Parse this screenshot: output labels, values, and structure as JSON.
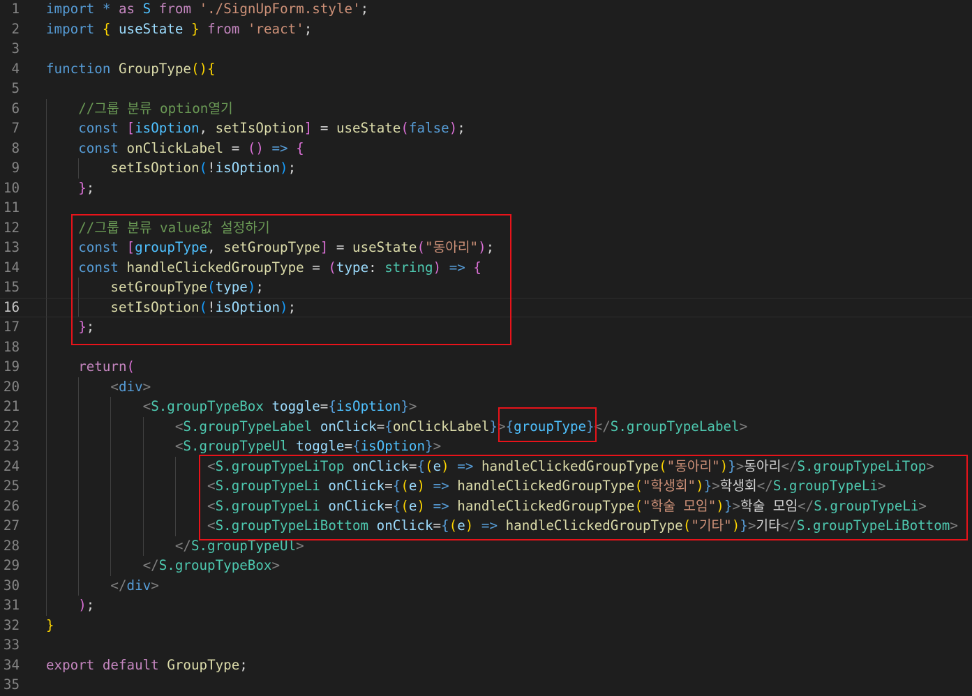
{
  "editor": {
    "current_line": 16,
    "colors": {
      "background": "#1e1e1e",
      "highlight_box": "#e8131a"
    },
    "lines": [
      {
        "n": "1",
        "tokens": [
          [
            "kw",
            "import"
          ],
          [
            "op",
            " "
          ],
          [
            "kw",
            "*"
          ],
          [
            "op",
            " "
          ],
          [
            "ctl",
            "as"
          ],
          [
            "op",
            " "
          ],
          [
            "cst",
            "S"
          ],
          [
            "op",
            " "
          ],
          [
            "ctl",
            "from"
          ],
          [
            "op",
            " "
          ],
          [
            "str",
            "'./SignUpForm.style'"
          ],
          [
            "op",
            ";"
          ]
        ]
      },
      {
        "n": "2",
        "tokens": [
          [
            "kw",
            "import"
          ],
          [
            "op",
            " "
          ],
          [
            "b1",
            "{"
          ],
          [
            "op",
            " "
          ],
          [
            "var",
            "useState"
          ],
          [
            "op",
            " "
          ],
          [
            "b1",
            "}"
          ],
          [
            "op",
            " "
          ],
          [
            "ctl",
            "from"
          ],
          [
            "op",
            " "
          ],
          [
            "str",
            "'react'"
          ],
          [
            "op",
            ";"
          ]
        ]
      },
      {
        "n": "3",
        "tokens": []
      },
      {
        "n": "4",
        "tokens": [
          [
            "kw",
            "function"
          ],
          [
            "op",
            " "
          ],
          [
            "fn",
            "GroupType"
          ],
          [
            "b1",
            "()"
          ],
          [
            "b1",
            "{"
          ]
        ]
      },
      {
        "n": "5",
        "tokens": []
      },
      {
        "n": "6",
        "tokens": [
          [
            "op",
            "    "
          ],
          [
            "cmt",
            "//그룹 분류 option열기"
          ]
        ]
      },
      {
        "n": "7",
        "tokens": [
          [
            "op",
            "    "
          ],
          [
            "kw",
            "const"
          ],
          [
            "op",
            " "
          ],
          [
            "b2",
            "["
          ],
          [
            "cst",
            "isOption"
          ],
          [
            "op",
            ", "
          ],
          [
            "fn",
            "setIsOption"
          ],
          [
            "b2",
            "]"
          ],
          [
            "op",
            " = "
          ],
          [
            "fn",
            "useState"
          ],
          [
            "b2",
            "("
          ],
          [
            "kw",
            "false"
          ],
          [
            "b2",
            ")"
          ],
          [
            "op",
            ";"
          ]
        ]
      },
      {
        "n": "8",
        "tokens": [
          [
            "op",
            "    "
          ],
          [
            "kw",
            "const"
          ],
          [
            "op",
            " "
          ],
          [
            "fn",
            "onClickLabel"
          ],
          [
            "op",
            " = "
          ],
          [
            "b2",
            "()"
          ],
          [
            "op",
            " "
          ],
          [
            "kw",
            "=>"
          ],
          [
            "op",
            " "
          ],
          [
            "b2",
            "{"
          ]
        ]
      },
      {
        "n": "9",
        "tokens": [
          [
            "op",
            "        "
          ],
          [
            "fn",
            "setIsOption"
          ],
          [
            "b3",
            "("
          ],
          [
            "op",
            "!"
          ],
          [
            "var",
            "isOption"
          ],
          [
            "b3",
            ")"
          ],
          [
            "op",
            ";"
          ]
        ]
      },
      {
        "n": "10",
        "tokens": [
          [
            "op",
            "    "
          ],
          [
            "b2",
            "}"
          ],
          [
            "op",
            ";"
          ]
        ]
      },
      {
        "n": "11",
        "tokens": []
      },
      {
        "n": "12",
        "tokens": [
          [
            "op",
            "    "
          ],
          [
            "cmt",
            "//그룹 분류 value값 설정하기"
          ]
        ]
      },
      {
        "n": "13",
        "tokens": [
          [
            "op",
            "    "
          ],
          [
            "kw",
            "const"
          ],
          [
            "op",
            " "
          ],
          [
            "b2",
            "["
          ],
          [
            "cst",
            "groupType"
          ],
          [
            "op",
            ", "
          ],
          [
            "fn",
            "setGroupType"
          ],
          [
            "b2",
            "]"
          ],
          [
            "op",
            " = "
          ],
          [
            "fn",
            "useState"
          ],
          [
            "b2",
            "("
          ],
          [
            "str",
            "\"동아리\""
          ],
          [
            "b2",
            ")"
          ],
          [
            "op",
            ";"
          ]
        ]
      },
      {
        "n": "14",
        "tokens": [
          [
            "op",
            "    "
          ],
          [
            "kw",
            "const"
          ],
          [
            "op",
            " "
          ],
          [
            "fn",
            "handleClickedGroupType"
          ],
          [
            "op",
            " = "
          ],
          [
            "b2",
            "("
          ],
          [
            "var",
            "type"
          ],
          [
            "op",
            ": "
          ],
          [
            "typ",
            "string"
          ],
          [
            "b2",
            ")"
          ],
          [
            "op",
            " "
          ],
          [
            "kw",
            "=>"
          ],
          [
            "op",
            " "
          ],
          [
            "b2",
            "{"
          ]
        ]
      },
      {
        "n": "15",
        "tokens": [
          [
            "op",
            "        "
          ],
          [
            "fn",
            "setGroupType"
          ],
          [
            "b3",
            "("
          ],
          [
            "var",
            "type"
          ],
          [
            "b3",
            ")"
          ],
          [
            "op",
            ";"
          ]
        ]
      },
      {
        "n": "16",
        "tokens": [
          [
            "op",
            "        "
          ],
          [
            "fn",
            "setIsOption"
          ],
          [
            "b3",
            "("
          ],
          [
            "op",
            "!"
          ],
          [
            "var",
            "isOption"
          ],
          [
            "b3",
            ")"
          ],
          [
            "op",
            ";"
          ]
        ]
      },
      {
        "n": "17",
        "tokens": [
          [
            "op",
            "    "
          ],
          [
            "b2",
            "}"
          ],
          [
            "op",
            ";"
          ]
        ]
      },
      {
        "n": "18",
        "tokens": []
      },
      {
        "n": "19",
        "tokens": [
          [
            "op",
            "    "
          ],
          [
            "ctl",
            "return"
          ],
          [
            "b2",
            "("
          ]
        ]
      },
      {
        "n": "20",
        "tokens": [
          [
            "op",
            "        "
          ],
          [
            "tag",
            "<"
          ],
          [
            "kw",
            "div"
          ],
          [
            "tag",
            ">"
          ]
        ]
      },
      {
        "n": "21",
        "tokens": [
          [
            "op",
            "            "
          ],
          [
            "tag",
            "<"
          ],
          [
            "typ",
            "S.groupTypeBox"
          ],
          [
            "op",
            " "
          ],
          [
            "var",
            "toggle"
          ],
          [
            "op",
            "="
          ],
          [
            "kw",
            "{"
          ],
          [
            "cst",
            "isOption"
          ],
          [
            "kw",
            "}"
          ],
          [
            "tag",
            ">"
          ]
        ]
      },
      {
        "n": "22",
        "tokens": [
          [
            "op",
            "                "
          ],
          [
            "tag",
            "<"
          ],
          [
            "typ",
            "S.groupTypeLabel"
          ],
          [
            "op",
            " "
          ],
          [
            "var",
            "onClick"
          ],
          [
            "op",
            "="
          ],
          [
            "kw",
            "{"
          ],
          [
            "fn",
            "onClickLabel"
          ],
          [
            "kw",
            "}"
          ],
          [
            "tag",
            ">"
          ],
          [
            "kw",
            "{"
          ],
          [
            "cst",
            "groupType"
          ],
          [
            "kw",
            "}"
          ],
          [
            "tag",
            "</"
          ],
          [
            "typ",
            "S.groupTypeLabel"
          ],
          [
            "tag",
            ">"
          ]
        ]
      },
      {
        "n": "23",
        "tokens": [
          [
            "op",
            "                "
          ],
          [
            "tag",
            "<"
          ],
          [
            "typ",
            "S.groupTypeUl"
          ],
          [
            "op",
            " "
          ],
          [
            "var",
            "toggle"
          ],
          [
            "op",
            "="
          ],
          [
            "kw",
            "{"
          ],
          [
            "cst",
            "isOption"
          ],
          [
            "kw",
            "}"
          ],
          [
            "tag",
            ">"
          ]
        ]
      },
      {
        "n": "24",
        "tokens": [
          [
            "op",
            "                    "
          ],
          [
            "tag",
            "<"
          ],
          [
            "typ",
            "S.groupTypeLiTop"
          ],
          [
            "op",
            " "
          ],
          [
            "var",
            "onClick"
          ],
          [
            "op",
            "="
          ],
          [
            "kw",
            "{"
          ],
          [
            "b1",
            "("
          ],
          [
            "var",
            "e"
          ],
          [
            "b1",
            ")"
          ],
          [
            "op",
            " "
          ],
          [
            "kw",
            "=>"
          ],
          [
            "op",
            " "
          ],
          [
            "fn",
            "handleClickedGroupType"
          ],
          [
            "b1",
            "("
          ],
          [
            "str",
            "\"동아리\""
          ],
          [
            "b1",
            ")"
          ],
          [
            "kw",
            "}"
          ],
          [
            "tag",
            ">"
          ],
          [
            "txt",
            "동아리"
          ],
          [
            "tag",
            "</"
          ],
          [
            "typ",
            "S.groupTypeLiTop"
          ],
          [
            "tag",
            ">"
          ]
        ]
      },
      {
        "n": "25",
        "tokens": [
          [
            "op",
            "                    "
          ],
          [
            "tag",
            "<"
          ],
          [
            "typ",
            "S.groupTypeLi"
          ],
          [
            "op",
            " "
          ],
          [
            "var",
            "onClick"
          ],
          [
            "op",
            "="
          ],
          [
            "kw",
            "{"
          ],
          [
            "b1",
            "("
          ],
          [
            "var",
            "e"
          ],
          [
            "b1",
            ")"
          ],
          [
            "op",
            " "
          ],
          [
            "kw",
            "=>"
          ],
          [
            "op",
            " "
          ],
          [
            "fn",
            "handleClickedGroupType"
          ],
          [
            "b1",
            "("
          ],
          [
            "str",
            "\"학생회\""
          ],
          [
            "b1",
            ")"
          ],
          [
            "kw",
            "}"
          ],
          [
            "tag",
            ">"
          ],
          [
            "txt",
            "학생회"
          ],
          [
            "tag",
            "</"
          ],
          [
            "typ",
            "S.groupTypeLi"
          ],
          [
            "tag",
            ">"
          ]
        ]
      },
      {
        "n": "26",
        "tokens": [
          [
            "op",
            "                    "
          ],
          [
            "tag",
            "<"
          ],
          [
            "typ",
            "S.groupTypeLi"
          ],
          [
            "op",
            " "
          ],
          [
            "var",
            "onClick"
          ],
          [
            "op",
            "="
          ],
          [
            "kw",
            "{"
          ],
          [
            "b1",
            "("
          ],
          [
            "var",
            "e"
          ],
          [
            "b1",
            ")"
          ],
          [
            "op",
            " "
          ],
          [
            "kw",
            "=>"
          ],
          [
            "op",
            " "
          ],
          [
            "fn",
            "handleClickedGroupType"
          ],
          [
            "b1",
            "("
          ],
          [
            "str",
            "\"학술 모임\""
          ],
          [
            "b1",
            ")"
          ],
          [
            "kw",
            "}"
          ],
          [
            "tag",
            ">"
          ],
          [
            "txt",
            "학술 모임"
          ],
          [
            "tag",
            "</"
          ],
          [
            "typ",
            "S.groupTypeLi"
          ],
          [
            "tag",
            ">"
          ]
        ]
      },
      {
        "n": "27",
        "tokens": [
          [
            "op",
            "                    "
          ],
          [
            "tag",
            "<"
          ],
          [
            "typ",
            "S.groupTypeLiBottom"
          ],
          [
            "op",
            " "
          ],
          [
            "var",
            "onClick"
          ],
          [
            "op",
            "="
          ],
          [
            "kw",
            "{"
          ],
          [
            "b1",
            "("
          ],
          [
            "var",
            "e"
          ],
          [
            "b1",
            ")"
          ],
          [
            "op",
            " "
          ],
          [
            "kw",
            "=>"
          ],
          [
            "op",
            " "
          ],
          [
            "fn",
            "handleClickedGroupType"
          ],
          [
            "b1",
            "("
          ],
          [
            "str",
            "\"기타\""
          ],
          [
            "b1",
            ")"
          ],
          [
            "kw",
            "}"
          ],
          [
            "tag",
            ">"
          ],
          [
            "txt",
            "기타"
          ],
          [
            "tag",
            "</"
          ],
          [
            "typ",
            "S.groupTypeLiBottom"
          ],
          [
            "tag",
            ">"
          ]
        ]
      },
      {
        "n": "28",
        "tokens": [
          [
            "op",
            "                "
          ],
          [
            "tag",
            "</"
          ],
          [
            "typ",
            "S.groupTypeUl"
          ],
          [
            "tag",
            ">"
          ]
        ]
      },
      {
        "n": "29",
        "tokens": [
          [
            "op",
            "            "
          ],
          [
            "tag",
            "</"
          ],
          [
            "typ",
            "S.groupTypeBox"
          ],
          [
            "tag",
            ">"
          ]
        ]
      },
      {
        "n": "30",
        "tokens": [
          [
            "op",
            "        "
          ],
          [
            "tag",
            "</"
          ],
          [
            "kw",
            "div"
          ],
          [
            "tag",
            ">"
          ]
        ]
      },
      {
        "n": "31",
        "tokens": [
          [
            "op",
            "    "
          ],
          [
            "b2",
            ")"
          ],
          [
            "op",
            ";"
          ]
        ]
      },
      {
        "n": "32",
        "tokens": [
          [
            "b1",
            "}"
          ]
        ]
      },
      {
        "n": "33",
        "tokens": []
      },
      {
        "n": "34",
        "tokens": [
          [
            "ctl",
            "export"
          ],
          [
            "op",
            " "
          ],
          [
            "ctl",
            "default"
          ],
          [
            "op",
            " "
          ],
          [
            "fn",
            "GroupType"
          ],
          [
            "op",
            ";"
          ]
        ]
      },
      {
        "n": "35",
        "tokens": []
      }
    ]
  }
}
